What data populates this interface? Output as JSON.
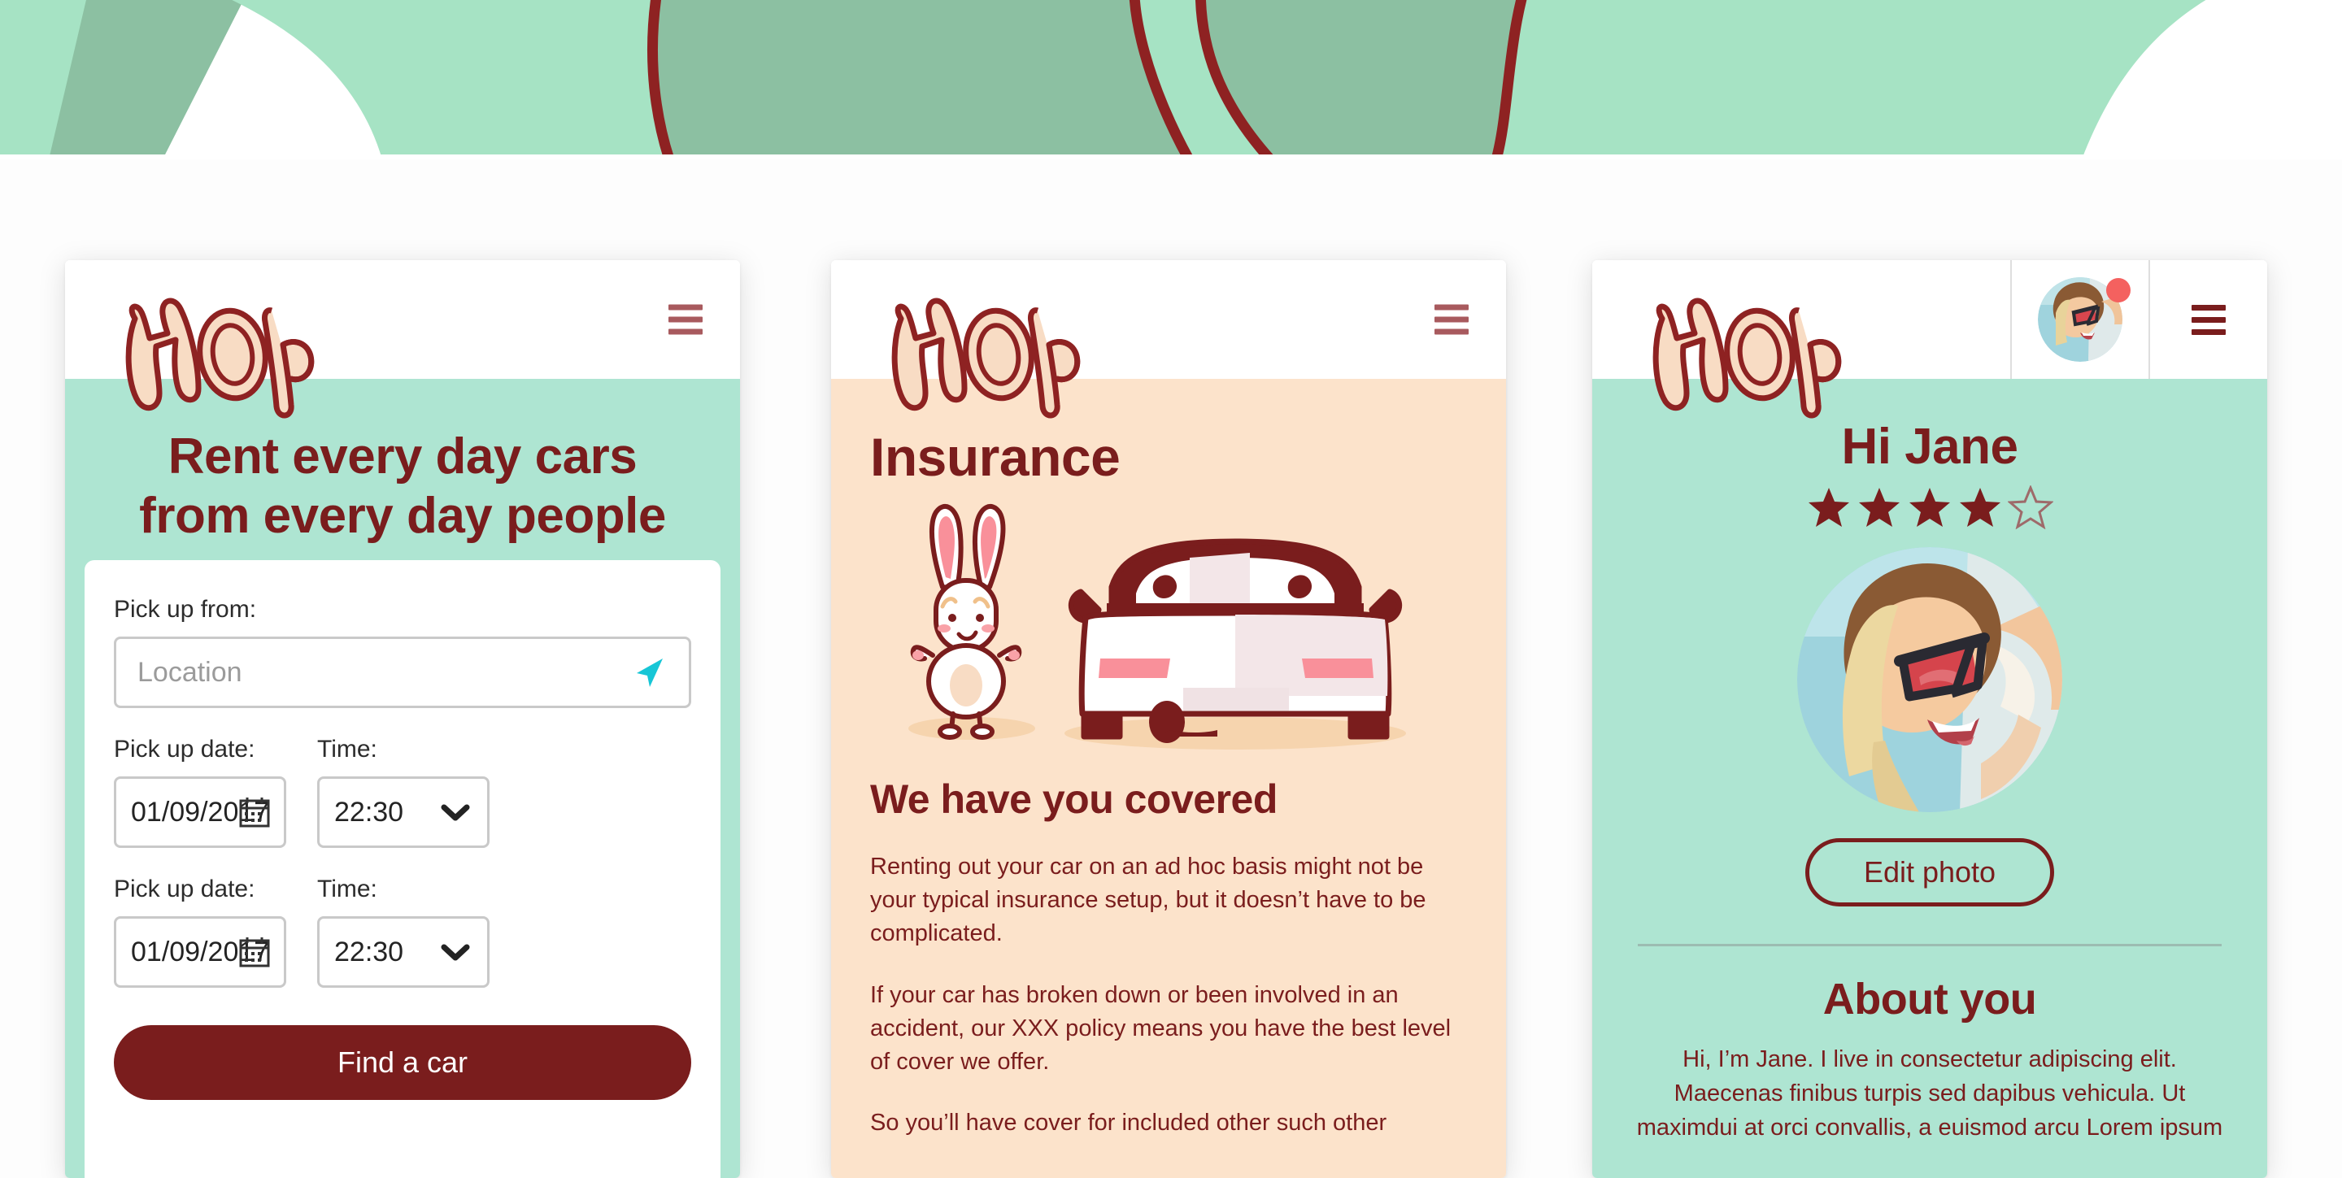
{
  "theme": {
    "maroon": "#7a1d1d",
    "mint": "#aee5d2",
    "peach": "#fce3cb",
    "cyan_accent": "#17c6d6",
    "notification_red": "#f4615f",
    "banner_green_light": "#a6e3c4",
    "banner_green_dark": "#8cc0a2"
  },
  "brand": {
    "logo_text": "HOP"
  },
  "card1": {
    "menu_icon": "hamburger-menu-icon",
    "title_line1": "Rent every day cars",
    "title_line2": "from every day people",
    "form": {
      "pickup_from_label": "Pick up from:",
      "location_placeholder": "Location",
      "locate_icon": "navigation-arrow-icon",
      "rows": [
        {
          "date_label": "Pick up date:",
          "date_value": "01/09/2017",
          "calendar_icon": "calendar-icon",
          "time_label": "Time:",
          "time_value": "22:30",
          "chevron_icon": "chevron-down-icon"
        },
        {
          "date_label": "Pick up date:",
          "date_value": "01/09/2017",
          "calendar_icon": "calendar-icon",
          "time_label": "Time:",
          "time_value": "22:30",
          "chevron_icon": "chevron-down-icon"
        }
      ],
      "submit_label": "Find a car"
    }
  },
  "card2": {
    "menu_icon": "hamburger-menu-icon",
    "title": "Insurance",
    "illustration": "bunny-and-car-illustration",
    "subtitle": "We have you covered",
    "paragraph1": "Renting out your car on an ad hoc basis might not be your typical insurance setup, but it doesn’t have to be complicated.",
    "paragraph2": "If your car has broken down or been involved in an accident, our XXX policy means you have the best level of cover we offer.",
    "paragraph3": "So you’ll have cover for included other such other"
  },
  "card3": {
    "menu_icon": "hamburger-menu-icon",
    "avatar_icon": "user-avatar-thumbnail",
    "notification_icon": "notification-dot",
    "greeting": "Hi Jane",
    "rating": {
      "filled": 4,
      "total": 5
    },
    "profile_photo": "profile-photo",
    "edit_photo_label": "Edit photo",
    "about_heading": "About you",
    "about_text": "Hi, I’m Jane. I live in consectetur adipiscing elit. Maecenas finibus turpis sed dapibus vehicula. Ut maximdui at orci convallis, a euismod arcu Lorem ipsum"
  }
}
